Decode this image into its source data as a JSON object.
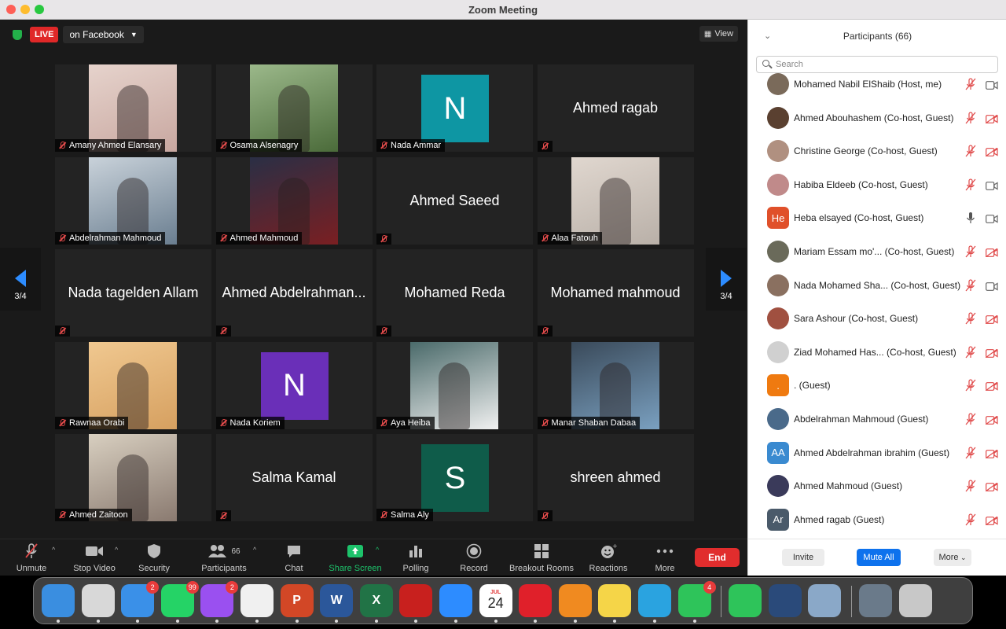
{
  "window": {
    "title": "Zoom Meeting"
  },
  "colors": {
    "accent": "#0e72ed",
    "end": "#e12d2d",
    "live": "#e02828",
    "share": "#1dc36b"
  },
  "live": {
    "badge": "LIVE",
    "platform": "on Facebook"
  },
  "view": {
    "label": "View"
  },
  "pager": {
    "left": "3/4",
    "right": "3/4"
  },
  "tiles": [
    {
      "name": "Amany Ahmed Elansary",
      "display": "",
      "kind": "photo"
    },
    {
      "name": "Osama Alsenagry",
      "display": "",
      "kind": "photo"
    },
    {
      "name": "Nada Ammar",
      "display": "",
      "kind": "avatar",
      "letter": "N",
      "color": "#0e96a3"
    },
    {
      "name": "",
      "display": "Ahmed ragab",
      "kind": "text"
    },
    {
      "name": "Abdelrahman Mahmoud",
      "display": "",
      "kind": "photo"
    },
    {
      "name": "Ahmed Mahmoud",
      "display": "",
      "kind": "photo"
    },
    {
      "name": "",
      "display": "Ahmed Saeed",
      "kind": "text"
    },
    {
      "name": "Alaa Fatouh",
      "display": "",
      "kind": "photo"
    },
    {
      "name": "",
      "display": "Nada tagelden Allam",
      "kind": "text"
    },
    {
      "name": "",
      "display": "Ahmed Abdelrahman...",
      "kind": "text"
    },
    {
      "name": "",
      "display": "Mohamed Reda",
      "kind": "text"
    },
    {
      "name": "",
      "display": "Mohamed mahmoud",
      "kind": "text"
    },
    {
      "name": "Rawnaa Orabi",
      "display": "",
      "kind": "photo"
    },
    {
      "name": "Nada Koriem",
      "display": "",
      "kind": "avatar",
      "letter": "N",
      "color": "#6a2fb8"
    },
    {
      "name": "Aya Heiba",
      "display": "",
      "kind": "photo"
    },
    {
      "name": "Manar Shaban Dabaa",
      "display": "",
      "kind": "photo"
    },
    {
      "name": "Ahmed Zaitoon",
      "display": "",
      "kind": "photo"
    },
    {
      "name": "",
      "display": "Salma Kamal",
      "kind": "text"
    },
    {
      "name": "Salma Aly",
      "display": "",
      "kind": "avatar",
      "letter": "S",
      "color": "#0f5c4a"
    },
    {
      "name": "",
      "display": "shreen ahmed",
      "kind": "text"
    }
  ],
  "toolbar": {
    "unmute": "Unmute",
    "stop_video": "Stop Video",
    "security": "Security",
    "participants": "Participants",
    "participants_count": "66",
    "chat": "Chat",
    "share_screen": "Share Screen",
    "polling": "Polling",
    "record": "Record",
    "breakout": "Breakout Rooms",
    "reactions": "Reactions",
    "more": "More",
    "end": "End"
  },
  "panel": {
    "title": "Participants (66)",
    "search_placeholder": "Search",
    "participants": [
      {
        "name": "Mohamed Nabil ElShaib (Host, me)",
        "initials": "",
        "color": "#7a6a5a",
        "mic": "muted",
        "cam": "on"
      },
      {
        "name": "Ahmed Abouhashem (Co-host, Guest)",
        "initials": "",
        "color": "#5a4030",
        "mic": "muted",
        "cam": "off"
      },
      {
        "name": "Christine George (Co-host, Guest)",
        "initials": "",
        "color": "#b09080",
        "mic": "muted",
        "cam": "off"
      },
      {
        "name": "Habiba Eldeeb (Co-host, Guest)",
        "initials": "",
        "color": "#c08a8a",
        "mic": "muted",
        "cam": "on"
      },
      {
        "name": "Heba elsayed (Co-host, Guest)",
        "initials": "He",
        "color": "#e0502a",
        "mic": "on",
        "cam": "on"
      },
      {
        "name": "Mariam Essam mo'...    (Co-host, Guest)",
        "initials": "",
        "color": "#6a6a5a",
        "mic": "muted",
        "cam": "off"
      },
      {
        "name": "Nada Mohamed Sha...  (Co-host, Guest)",
        "initials": "",
        "color": "#8a7060",
        "mic": "muted",
        "cam": "on"
      },
      {
        "name": "Sara Ashour (Co-host, Guest)",
        "initials": "",
        "color": "#a05040",
        "mic": "muted",
        "cam": "off"
      },
      {
        "name": "Ziad Mohamed Has...  (Co-host, Guest)",
        "initials": "",
        "color": "#d0d0d0",
        "mic": "muted",
        "cam": "off"
      },
      {
        "name": ". (Guest)",
        "initials": ".",
        "color": "#ef7a10",
        "mic": "muted",
        "cam": "off"
      },
      {
        "name": "Abdelrahman Mahmoud (Guest)",
        "initials": "",
        "color": "#4a6a8a",
        "mic": "muted",
        "cam": "off"
      },
      {
        "name": "Ahmed Abdelrahman ibrahim (Guest)",
        "initials": "AA",
        "color": "#3a8ad0",
        "mic": "muted",
        "cam": "off"
      },
      {
        "name": "Ahmed Mahmoud (Guest)",
        "initials": "",
        "color": "#3a3a5a",
        "mic": "muted",
        "cam": "off"
      },
      {
        "name": "Ahmed ragab (Guest)",
        "initials": "Ar",
        "color": "#4a5a6a",
        "mic": "muted",
        "cam": "off"
      }
    ],
    "invite": "Invite",
    "mute_all": "Mute All",
    "more": "More"
  },
  "dock": {
    "items": [
      {
        "name": "Finder",
        "label": "",
        "color": "#3a8ee0",
        "badge": ""
      },
      {
        "name": "Launchpad",
        "label": "",
        "color": "#d8d8d8",
        "badge": ""
      },
      {
        "name": "Mail",
        "label": "",
        "color": "#3a90e8",
        "badge": "2"
      },
      {
        "name": "WhatsApp",
        "label": "",
        "color": "#25d366",
        "badge": "99"
      },
      {
        "name": "Messenger",
        "label": "",
        "color": "#9a50f0",
        "badge": "2"
      },
      {
        "name": "Chrome",
        "label": "",
        "color": "#f0f0f0",
        "badge": ""
      },
      {
        "name": "PowerPoint",
        "label": "P",
        "color": "#d24726",
        "badge": ""
      },
      {
        "name": "Word",
        "label": "W",
        "color": "#2b579a",
        "badge": ""
      },
      {
        "name": "Excel",
        "label": "X",
        "color": "#217346",
        "badge": ""
      },
      {
        "name": "Acrobat",
        "label": "",
        "color": "#c8201e",
        "badge": ""
      },
      {
        "name": "Zoom",
        "label": "",
        "color": "#2d8cff",
        "badge": ""
      },
      {
        "name": "Calendar",
        "label": "24",
        "month": "JUL",
        "color": "#ffffff",
        "badge": ""
      },
      {
        "name": "Recorder",
        "label": "",
        "color": "#e0202a",
        "badge": ""
      },
      {
        "name": "Books",
        "label": "",
        "color": "#f08a20",
        "badge": ""
      },
      {
        "name": "Notes",
        "label": "",
        "color": "#f5d548",
        "badge": ""
      },
      {
        "name": "Telegram",
        "label": "",
        "color": "#2aa3e0",
        "badge": ""
      },
      {
        "name": "FaceTime",
        "label": "",
        "color": "#2ec45a",
        "badge": "4"
      },
      {
        "name": "Messages",
        "label": "",
        "color": "#2ec45a",
        "badge": ""
      },
      {
        "name": "QuickTime",
        "label": "",
        "color": "#2a4a7a",
        "badge": ""
      },
      {
        "name": "Preview",
        "label": "",
        "color": "#8aa8c8",
        "badge": ""
      },
      {
        "name": "Downloads",
        "label": "",
        "color": "#6a7a8a",
        "badge": ""
      },
      {
        "name": "Trash",
        "label": "",
        "color": "#c8c8c8",
        "badge": ""
      }
    ]
  }
}
